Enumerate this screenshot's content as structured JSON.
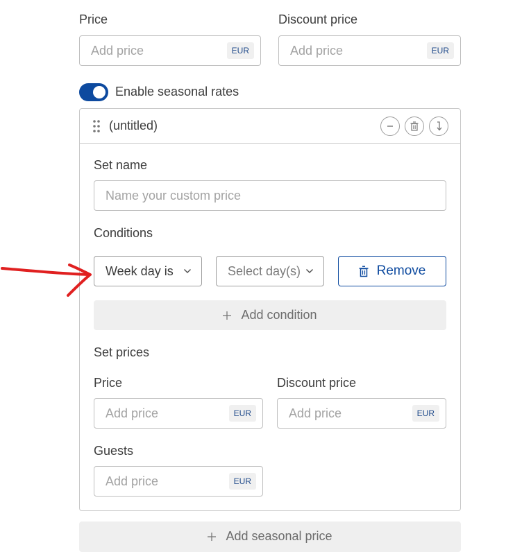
{
  "base_prices": {
    "price_label": "Price",
    "price_placeholder": "Add price",
    "discount_label": "Discount price",
    "discount_placeholder": "Add price",
    "currency": "EUR"
  },
  "seasonal_toggle": {
    "label": "Enable seasonal rates",
    "enabled": true
  },
  "seasonal_card": {
    "title": "(untitled)",
    "set_name_label": "Set name",
    "set_name_placeholder": "Name your custom price",
    "conditions_label": "Conditions",
    "condition": {
      "type_value": "Week day is",
      "days_placeholder": "Select day(s)",
      "remove_label": "Remove"
    },
    "add_condition_label": "Add condition",
    "set_prices_label": "Set prices",
    "price_label": "Price",
    "price_placeholder": "Add price",
    "discount_label": "Discount price",
    "discount_placeholder": "Add price",
    "guests_label": "Guests",
    "guests_placeholder": "Add price",
    "currency": "EUR"
  },
  "add_seasonal_label": "Add seasonal price",
  "colors": {
    "accent": "#0d4a9f",
    "annotation": "#e02020"
  }
}
